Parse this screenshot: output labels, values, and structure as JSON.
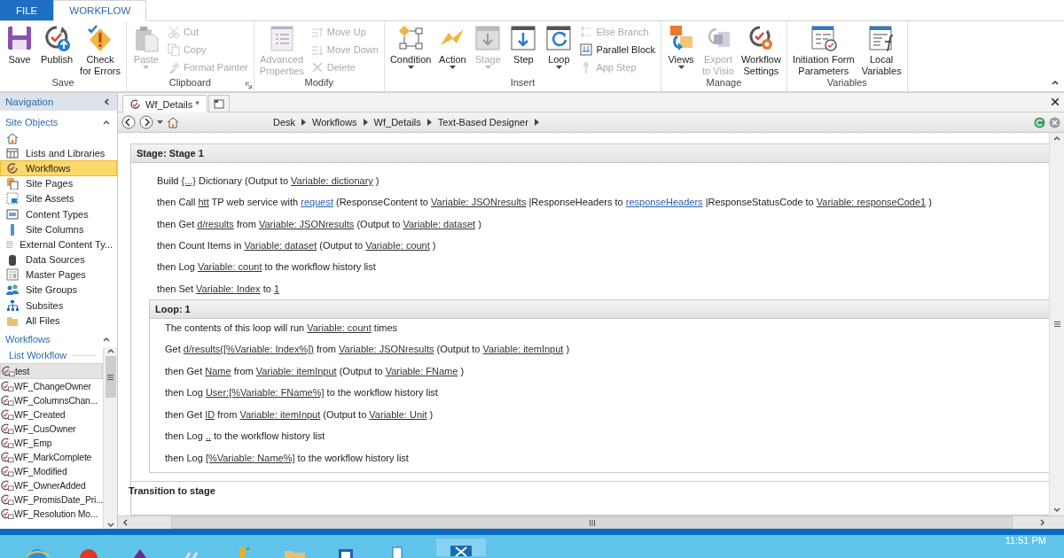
{
  "ribbon": {
    "tabs": [
      {
        "label": "FILE",
        "selected": false
      },
      {
        "label": "WORKFLOW",
        "selected": true
      }
    ],
    "groups": [
      {
        "label": "Save",
        "launcher": false,
        "large": [
          {
            "label": "Save",
            "disabled": false,
            "dropdown": false
          },
          {
            "label": "Publish",
            "disabled": false,
            "dropdown": false
          },
          {
            "label": "Check\nfor Errors",
            "disabled": false,
            "dropdown": false
          }
        ]
      },
      {
        "label": "Clipboard",
        "launcher": true,
        "large": [
          {
            "label": "Paste",
            "disabled": true,
            "dropdown": true
          }
        ],
        "small": [
          {
            "label": "Cut",
            "disabled": true
          },
          {
            "label": "Copy",
            "disabled": true
          },
          {
            "label": "Format Painter",
            "disabled": true
          }
        ]
      },
      {
        "label": "Modify",
        "launcher": false,
        "large": [
          {
            "label": "Advanced\nProperties",
            "disabled": true,
            "dropdown": false
          }
        ],
        "small": [
          {
            "label": "Move Up",
            "disabled": true
          },
          {
            "label": "Move Down",
            "disabled": true
          },
          {
            "label": "Delete",
            "disabled": true
          }
        ]
      },
      {
        "label": "Insert",
        "launcher": false,
        "large": [
          {
            "label": "Condition",
            "disabled": false,
            "dropdown": true
          },
          {
            "label": "Action",
            "disabled": false,
            "dropdown": true
          },
          {
            "label": "Stage",
            "disabled": true,
            "dropdown": true
          },
          {
            "label": "Step",
            "disabled": false,
            "dropdown": false
          },
          {
            "label": "Loop",
            "disabled": false,
            "dropdown": true
          }
        ],
        "small": [
          {
            "label": "Else Branch",
            "disabled": true
          },
          {
            "label": "Parallel Block",
            "disabled": false
          },
          {
            "label": "App Step",
            "disabled": true
          }
        ]
      },
      {
        "label": "Manage",
        "launcher": false,
        "large": [
          {
            "label": "Views",
            "disabled": false,
            "dropdown": true
          },
          {
            "label": "Export\nto Visio",
            "disabled": true,
            "dropdown": false
          },
          {
            "label": "Workflow\nSettings",
            "disabled": false,
            "dropdown": false
          }
        ]
      },
      {
        "label": "Variables",
        "launcher": false,
        "large": [
          {
            "label": "Initiation Form\nParameters",
            "disabled": false,
            "dropdown": false
          },
          {
            "label": "Local\nVariables",
            "disabled": false,
            "dropdown": false
          }
        ]
      }
    ]
  },
  "sidebar": {
    "header": "Navigation",
    "sections": [
      {
        "title": "Site Objects",
        "expanded": true,
        "items": [
          {
            "selected": false
          },
          {
            "label": "Lists and Libraries",
            "selected": false
          },
          {
            "label": "Workflows",
            "selected": true
          },
          {
            "label": "Site Pages",
            "selected": false
          },
          {
            "label": "Site Assets",
            "selected": false
          },
          {
            "label": "Content Types",
            "selected": false
          },
          {
            "label": "Site Columns",
            "selected": false
          },
          {
            "label": "External Content Ty...",
            "selected": false
          },
          {
            "label": "Data Sources",
            "selected": false
          },
          {
            "label": "Master Pages",
            "selected": false
          },
          {
            "label": "Site Groups",
            "selected": false
          },
          {
            "label": "Subsites",
            "selected": false
          },
          {
            "label": "All Files",
            "selected": false
          }
        ]
      },
      {
        "title": "Workflows",
        "expanded": true,
        "subheader": "List Workflow",
        "items": [
          {
            "label": "test",
            "selected": true
          },
          {
            "label": "WF_ChangeOwner",
            "selected": false
          },
          {
            "label": "WF_ColumnsChan...",
            "selected": false
          },
          {
            "label": "WF_Created",
            "selected": false
          },
          {
            "label": "WF_CusOwner",
            "selected": false
          },
          {
            "label": "WF_Emp",
            "selected": false
          },
          {
            "label": "WF_MarkComplete",
            "selected": false
          },
          {
            "label": "WF_Modified",
            "selected": false
          },
          {
            "label": "WF_OwnerAdded",
            "selected": false
          },
          {
            "label": "WF_PromisDate_Pri...",
            "selected": false
          },
          {
            "label": "WF_Resolution Mo...",
            "selected": false
          }
        ]
      }
    ]
  },
  "editor": {
    "tabs": [
      {
        "label": "Wf_Details *",
        "selected": true
      }
    ],
    "breadcrumb": [
      "Desk",
      "Workflows",
      "Wf_Details",
      "Text-Based Designer"
    ],
    "stage": {
      "title": "Stage: Stage 1",
      "steps": [
        [
          {
            "kind": "text",
            "text": "Build "
          },
          {
            "kind": "var",
            "text": "{...}"
          },
          {
            "kind": "text",
            "text": " Dictionary (Output to "
          },
          {
            "kind": "var",
            "text": "Variable: dictionary"
          },
          {
            "kind": "text",
            "text": " )"
          }
        ],
        [
          {
            "kind": "text",
            "text": "then Call "
          },
          {
            "kind": "var",
            "text": "htt"
          },
          {
            "kind": "text",
            "text": " TP web service with "
          },
          {
            "kind": "param",
            "text": "request"
          },
          {
            "kind": "text",
            "text": " (ResponseContent to "
          },
          {
            "kind": "var",
            "text": "Variable: JSONresults"
          },
          {
            "kind": "text",
            "text": " |ResponseHeaders to "
          },
          {
            "kind": "param",
            "text": "responseHeaders"
          },
          {
            "kind": "text",
            "text": " |ResponseStatusCode to "
          },
          {
            "kind": "var",
            "text": "Variable: responseCode1"
          },
          {
            "kind": "text",
            "text": " )"
          }
        ],
        [
          {
            "kind": "text",
            "text": "then Get "
          },
          {
            "kind": "var",
            "text": "d/results"
          },
          {
            "kind": "text",
            "text": " from "
          },
          {
            "kind": "var",
            "text": "Variable: JSONresults"
          },
          {
            "kind": "text",
            "text": " (Output to "
          },
          {
            "kind": "var",
            "text": "Variable: dataset"
          },
          {
            "kind": "text",
            "text": " )"
          }
        ],
        [
          {
            "kind": "text",
            "text": "then Count Items in "
          },
          {
            "kind": "var",
            "text": "Variable: dataset"
          },
          {
            "kind": "text",
            "text": " (Output to "
          },
          {
            "kind": "var",
            "text": "Variable: count"
          },
          {
            "kind": "text",
            "text": " )"
          }
        ],
        [
          {
            "kind": "text",
            "text": "then Log "
          },
          {
            "kind": "var",
            "text": "Variable: count"
          },
          {
            "kind": "text",
            "text": " to the workflow history list"
          }
        ],
        [
          {
            "kind": "text",
            "text": "then Set "
          },
          {
            "kind": "var",
            "text": "Variable: Index"
          },
          {
            "kind": "text",
            "text": " to "
          },
          {
            "kind": "var",
            "text": "1"
          }
        ]
      ],
      "loop": {
        "title": "Loop: 1",
        "intro": [
          {
            "kind": "text",
            "text": "The contents of this loop will run "
          },
          {
            "kind": "var",
            "text": "Variable: count"
          },
          {
            "kind": "text",
            "text": " times"
          }
        ],
        "steps": [
          [
            {
              "kind": "text",
              "text": "Get "
            },
            {
              "kind": "var",
              "text": "d/results([%Variable: Index%])"
            },
            {
              "kind": "text",
              "text": " from "
            },
            {
              "kind": "var",
              "text": "Variable: JSONresults"
            },
            {
              "kind": "text",
              "text": " (Output to "
            },
            {
              "kind": "var",
              "text": "Variable: itemInput"
            },
            {
              "kind": "text",
              "text": " )"
            }
          ],
          [
            {
              "kind": "text",
              "text": "then Get "
            },
            {
              "kind": "var",
              "text": "Name"
            },
            {
              "kind": "text",
              "text": " from "
            },
            {
              "kind": "var",
              "text": "Variable: itemInput"
            },
            {
              "kind": "text",
              "text": " (Output to "
            },
            {
              "kind": "var",
              "text": "Variable: FName"
            },
            {
              "kind": "text",
              "text": " )"
            }
          ],
          [
            {
              "kind": "text",
              "text": "then Log "
            },
            {
              "kind": "var",
              "text": "User:[%Variable: FName%]"
            },
            {
              "kind": "text",
              "text": " to the workflow history list"
            }
          ],
          [
            {
              "kind": "text",
              "text": "then Get "
            },
            {
              "kind": "var",
              "text": "ID"
            },
            {
              "kind": "text",
              "text": " from "
            },
            {
              "kind": "var",
              "text": "Variable: itemInput"
            },
            {
              "kind": "text",
              "text": " (Output to "
            },
            {
              "kind": "var",
              "text": "Variable: Unit"
            },
            {
              "kind": "text",
              "text": " )"
            }
          ],
          [
            {
              "kind": "text",
              "text": "then Log "
            },
            {
              "kind": "var",
              "text": ".."
            },
            {
              "kind": "text",
              "text": " to the workflow history list"
            }
          ],
          [
            {
              "kind": "text",
              "text": "then Log "
            },
            {
              "kind": "var",
              "text": "[%Variable: Name%]"
            },
            {
              "kind": "text",
              "text": " to the workflow history list"
            }
          ]
        ]
      },
      "transition": "Transition to stage"
    }
  },
  "taskbar": {
    "clock": "11:51 PM"
  }
}
